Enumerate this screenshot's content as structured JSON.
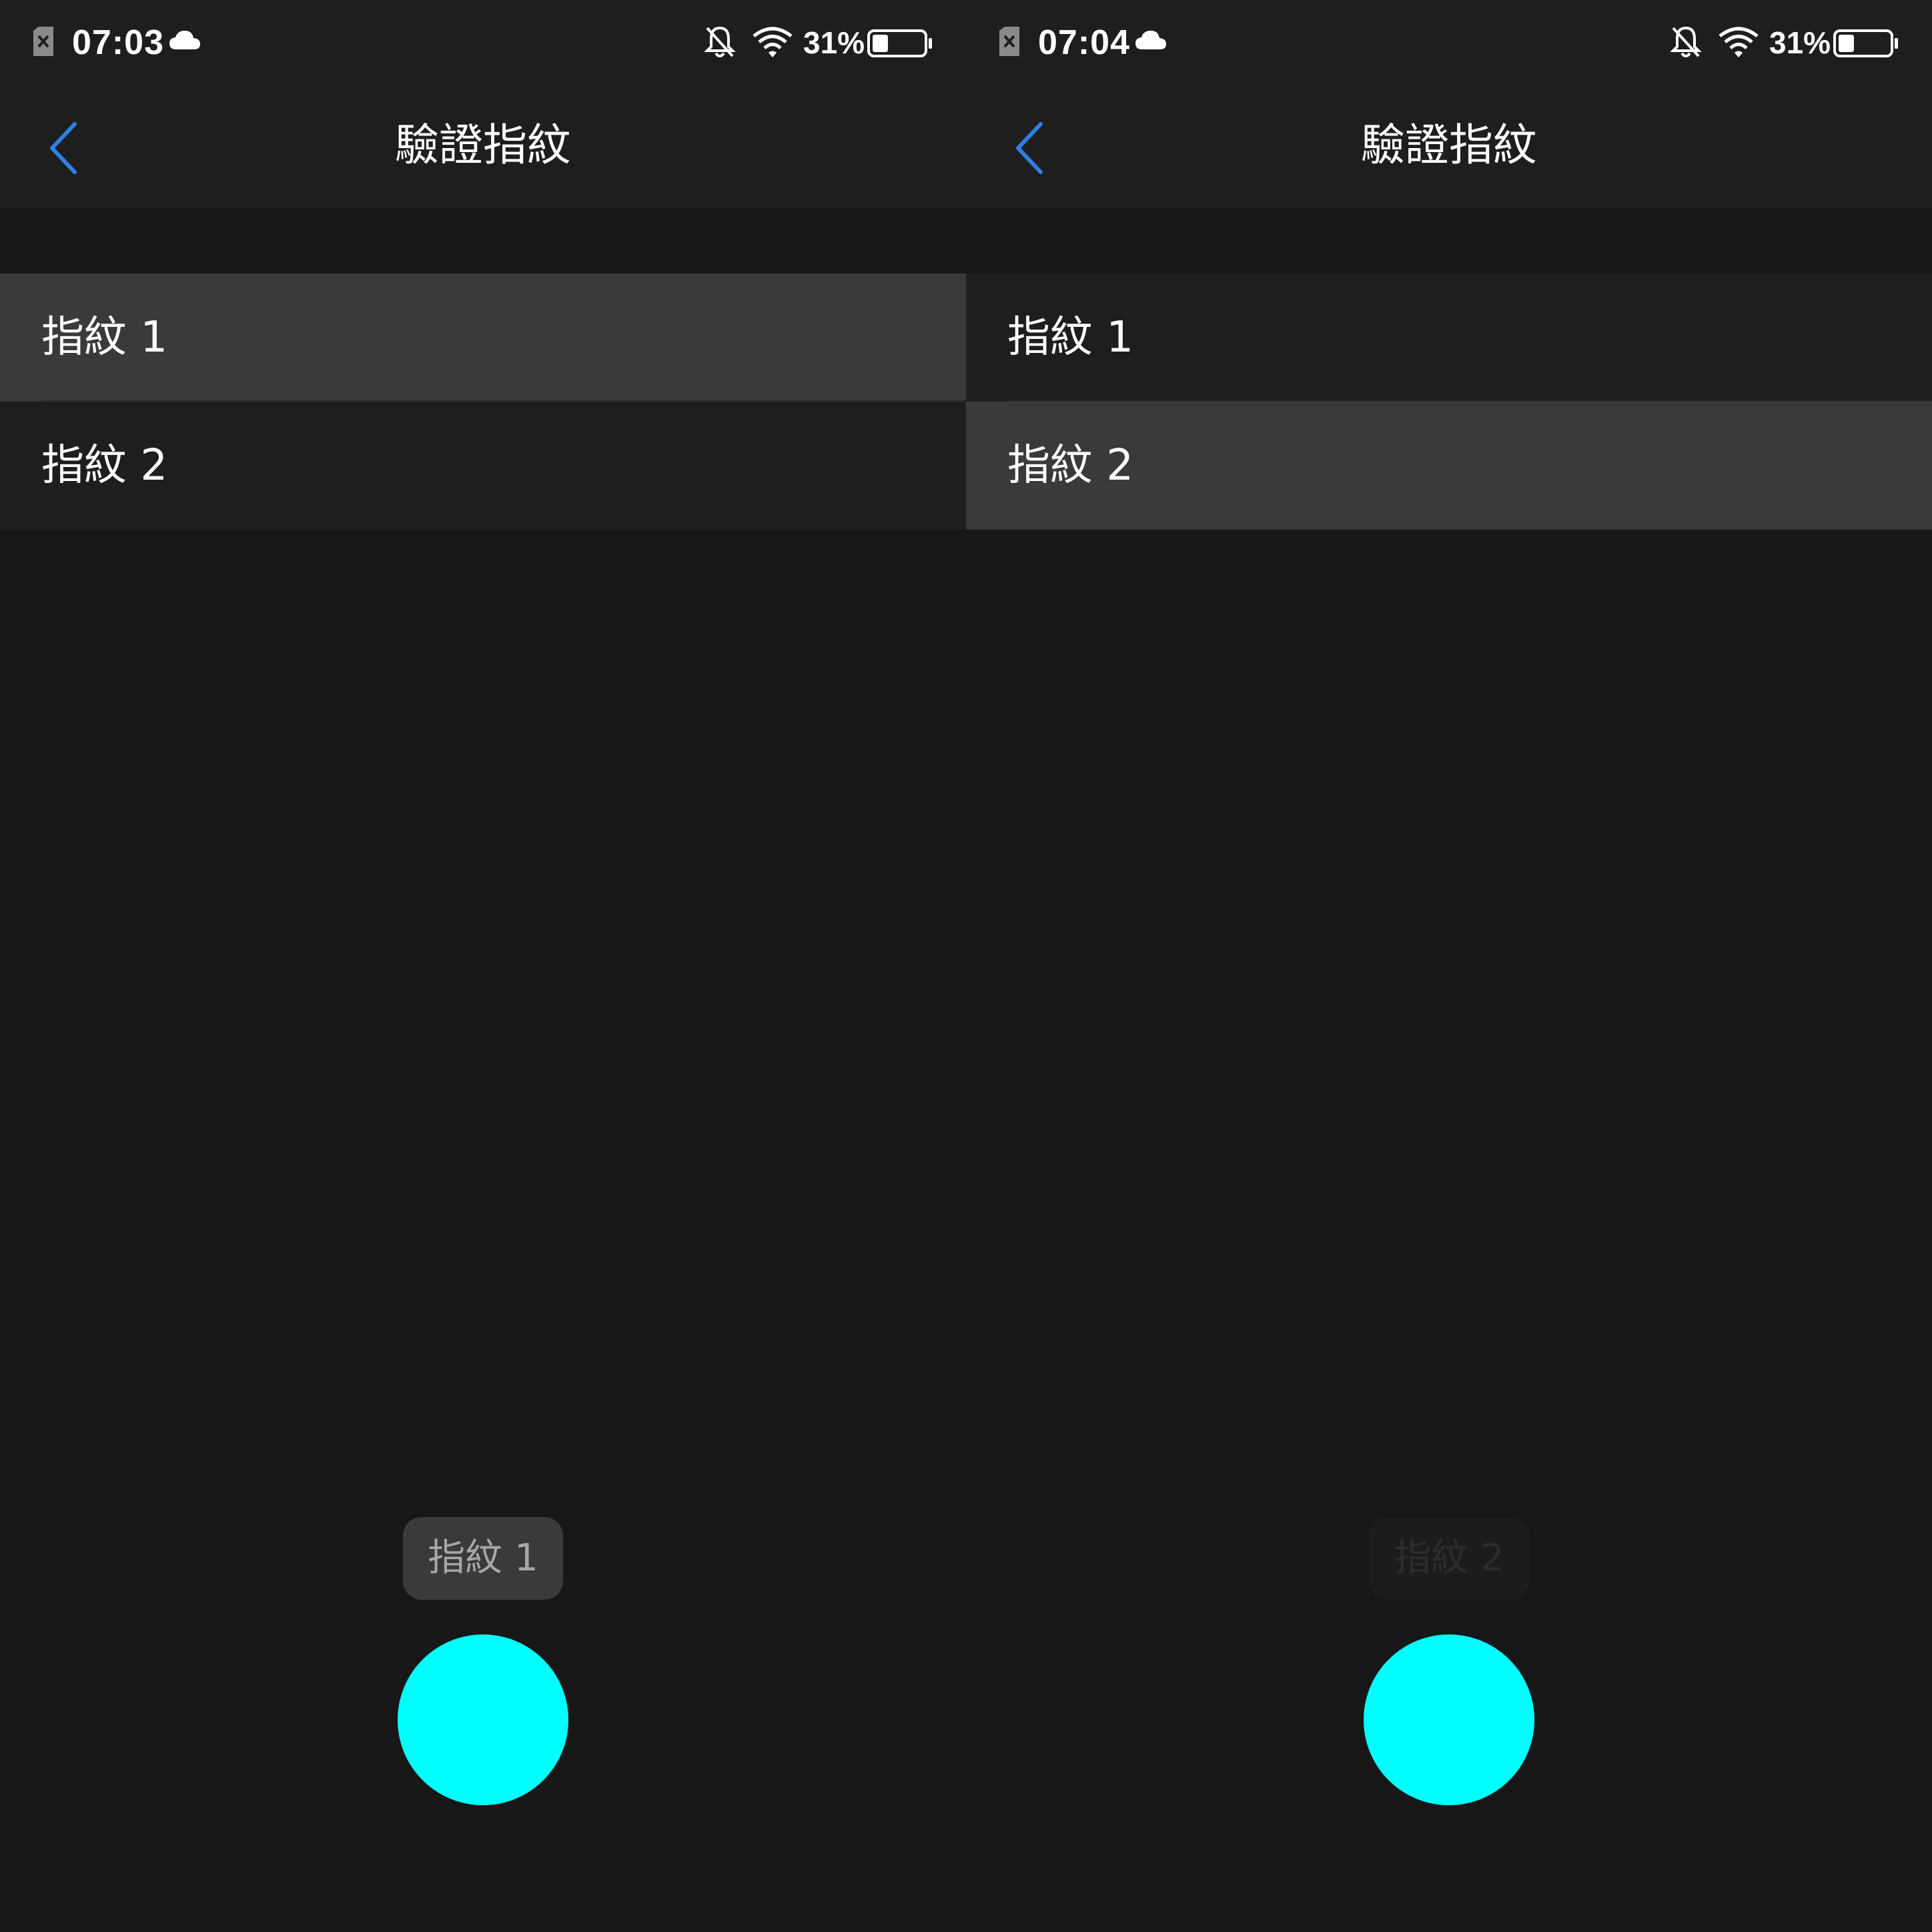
{
  "colors": {
    "background": "#171717",
    "surface": "#1e1e1f",
    "selected_row": "#3a3a3a",
    "accent_blue": "#2f7fe6",
    "touch_indicator": "#00ffff"
  },
  "screens": [
    {
      "status": {
        "sim_icon": "sim-off-icon",
        "time": "07:03",
        "cloud_icon": "cloud-icon",
        "bell_icon": "bell-off-icon",
        "wifi_icon": "wifi-icon",
        "battery_percent": "31%",
        "battery_level": 0.31
      },
      "header": {
        "back_icon": "chevron-left-icon",
        "title": "驗證指紋"
      },
      "list": [
        {
          "label": "指紋 1",
          "selected": true
        },
        {
          "label": "指紋 2",
          "selected": false
        }
      ],
      "toast": {
        "text": "指紋 1",
        "faded": false
      }
    },
    {
      "status": {
        "sim_icon": "sim-off-icon",
        "time": "07:04",
        "cloud_icon": "cloud-icon",
        "bell_icon": "bell-off-icon",
        "wifi_icon": "wifi-icon",
        "battery_percent": "31%",
        "battery_level": 0.31
      },
      "header": {
        "back_icon": "chevron-left-icon",
        "title": "驗證指紋"
      },
      "list": [
        {
          "label": "指紋 1",
          "selected": false
        },
        {
          "label": "指紋 2",
          "selected": true
        }
      ],
      "toast": {
        "text": "指紋 2",
        "faded": true
      }
    }
  ]
}
